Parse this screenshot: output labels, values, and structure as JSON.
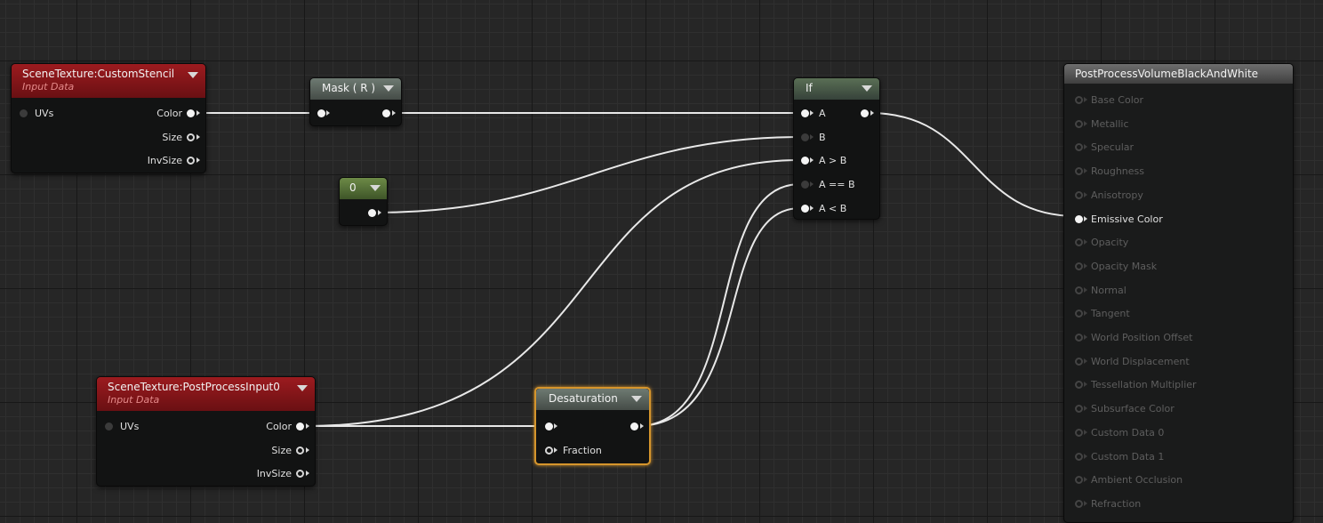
{
  "nodes": {
    "custom_stencil": {
      "title": "SceneTexture:CustomStencil",
      "subtitle": "Input Data",
      "inputs": [
        "UVs"
      ],
      "outputs": [
        "Color",
        "Size",
        "InvSize"
      ]
    },
    "mask": {
      "title": "Mask ( R )"
    },
    "constant": {
      "title": "0"
    },
    "if_node": {
      "title": "If",
      "inputs": [
        "A",
        "B",
        "A > B",
        "A == B",
        "A < B"
      ]
    },
    "post_process_input": {
      "title": "SceneTexture:PostProcessInput0",
      "subtitle": "Input Data",
      "inputs": [
        "UVs"
      ],
      "outputs": [
        "Color",
        "Size",
        "InvSize"
      ]
    },
    "desaturation": {
      "title": "Desaturation",
      "inputs": [
        "Fraction"
      ]
    },
    "result": {
      "title": "PostProcessVolumeBlackAndWhite",
      "pins": [
        "Base Color",
        "Metallic",
        "Specular",
        "Roughness",
        "Anisotropy",
        "Emissive Color",
        "Opacity",
        "Opacity Mask",
        "Normal",
        "Tangent",
        "World Position Offset",
        "World Displacement",
        "Tessellation Multiplier",
        "Subsurface Color",
        "Custom Data 0",
        "Custom Data 1",
        "Ambient Occlusion",
        "Refraction"
      ],
      "active_pin": "Emissive Color"
    }
  },
  "colors": {
    "wire": "#e8e8e8",
    "selection": "#d6952c",
    "scene_texture_header": "#9c1b1f",
    "constant_header": "#6d8a47"
  }
}
